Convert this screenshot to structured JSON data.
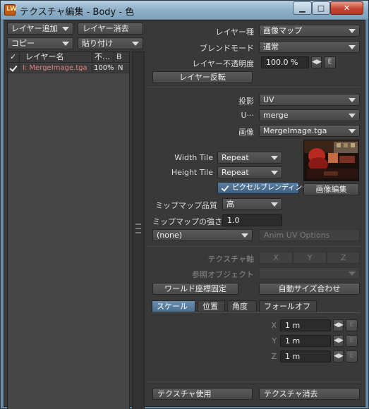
{
  "window": {
    "title": "テクスチャ編集 - Body - 色",
    "icon_text": "LW",
    "minimize": "▁",
    "maximize": "□",
    "close": "✕"
  },
  "left_toolbar": {
    "add_layer": "レイヤー追加",
    "remove_layer": "レイヤー消去",
    "copy": "コピー",
    "paste": "貼り付け"
  },
  "layer_list": {
    "headers": [
      "✓",
      "レイヤー名",
      "不…",
      "B"
    ],
    "rows": [
      {
        "name": "I: MergeImage.tga",
        "opacity": "100%",
        "blend": "N"
      }
    ]
  },
  "layer_props": {
    "layer_type_label": "レイヤー種",
    "layer_type_value": "画像マップ",
    "blend_mode_label": "ブレンドモード",
    "blend_mode_value": "通常",
    "opacity_label": "レイヤー不透明度",
    "opacity_value": "100.0 %",
    "env_button": "E",
    "invert_button": "レイヤー反転"
  },
  "projection": {
    "projection_label": "投影",
    "projection_value": "UV",
    "uvmap_label": "U···",
    "uvmap_value": "merge",
    "image_label": "画像",
    "image_value": "MergeImage.tga",
    "width_tile_label": "Width Tile",
    "width_tile_value": "Repeat",
    "height_tile_label": "Height Tile",
    "height_tile_value": "Repeat",
    "pixel_blending": "ピクセルブレンディング",
    "edit_image": "画像編集",
    "mipmap_quality_label": "ミップマップ品質",
    "mipmap_quality_value": "高",
    "mipmap_strength_label": "ミップマップの強さ",
    "mipmap_strength_value": "1.0",
    "none_value": "(none)",
    "anim_uv": "Anim UV Options"
  },
  "axis": {
    "texture_axis_label": "テクスチャ軸",
    "x": "X",
    "y": "Y",
    "z": "Z",
    "ref_object_label": "参照オブジェクト",
    "world_coords": "ワールド座標固定",
    "auto_size": "自動サイズ合わせ"
  },
  "tabs": [
    "スケール",
    "位置",
    "角度",
    "フォールオフ"
  ],
  "scale": {
    "x_label": "X",
    "x_value": "1 m",
    "y_label": "Y",
    "y_value": "1 m",
    "z_label": "Z",
    "z_value": "1 m",
    "env": "E"
  },
  "footer": {
    "use_texture": "テクスチャ使用",
    "remove_texture": "テクスチャ消去"
  },
  "colors": {
    "panel_bg": "#393939",
    "accent_tab": "#5a7fa3",
    "title_bar": "#9dbbd2"
  }
}
